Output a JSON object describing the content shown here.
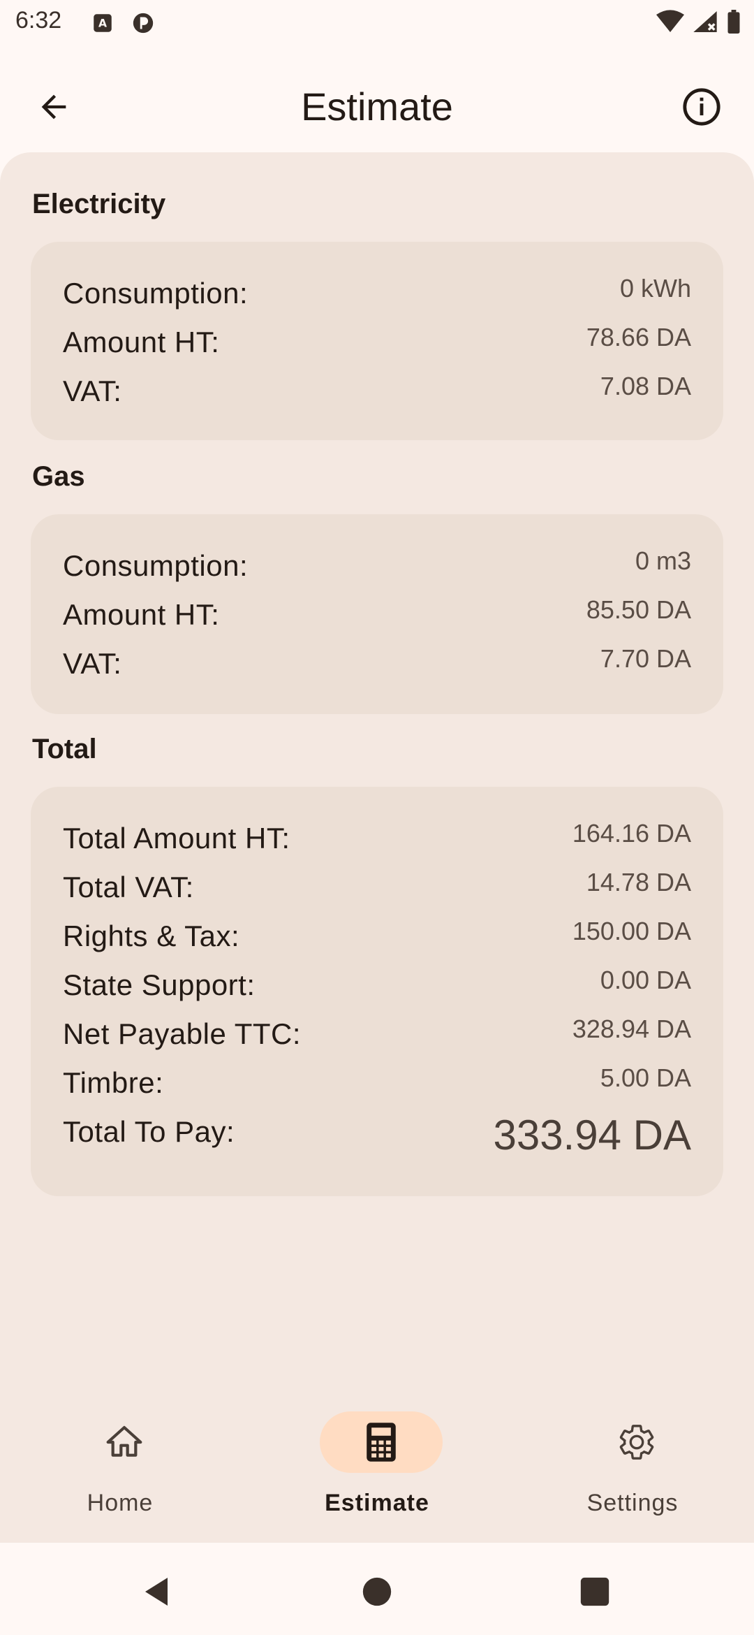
{
  "status_bar": {
    "time": "6:32"
  },
  "app_bar": {
    "title": "Estimate"
  },
  "electricity": {
    "section_title": "Electricity",
    "rows": [
      {
        "label": "Consumption:",
        "value": "0 kWh"
      },
      {
        "label": "Amount HT:",
        "value": "78.66 DA"
      },
      {
        "label": "VAT:",
        "value": "7.08 DA"
      }
    ]
  },
  "gas": {
    "section_title": "Gas",
    "rows": [
      {
        "label": "Consumption:",
        "value": "0 m3"
      },
      {
        "label": "Amount HT:",
        "value": "85.50 DA"
      },
      {
        "label": "VAT:",
        "value": "7.70 DA"
      }
    ]
  },
  "total": {
    "section_title": "Total",
    "rows": [
      {
        "label": "Total Amount HT:",
        "value": "164.16 DA"
      },
      {
        "label": "Total VAT:",
        "value": "14.78 DA"
      },
      {
        "label": "Rights & Tax:",
        "value": "150.00 DA"
      },
      {
        "label": "State Support:",
        "value": "0.00 DA"
      },
      {
        "label": "Net Payable TTC:",
        "value": "328.94 DA"
      },
      {
        "label": "Timbre:",
        "value": "5.00 DA"
      },
      {
        "label": "Total To Pay:",
        "value": "333.94 DA"
      }
    ]
  },
  "bottom_nav": {
    "items": [
      {
        "label": "Home",
        "icon": "home-icon",
        "active": false
      },
      {
        "label": "Estimate",
        "icon": "calculator-icon",
        "active": true
      },
      {
        "label": "Settings",
        "icon": "gear-icon",
        "active": false
      }
    ]
  },
  "colors": {
    "background": "#fff8f5",
    "sheet": "#f4e8e1",
    "card": "#ecdfd5",
    "active_pill": "#ffdcc2",
    "text": "#231a15"
  }
}
